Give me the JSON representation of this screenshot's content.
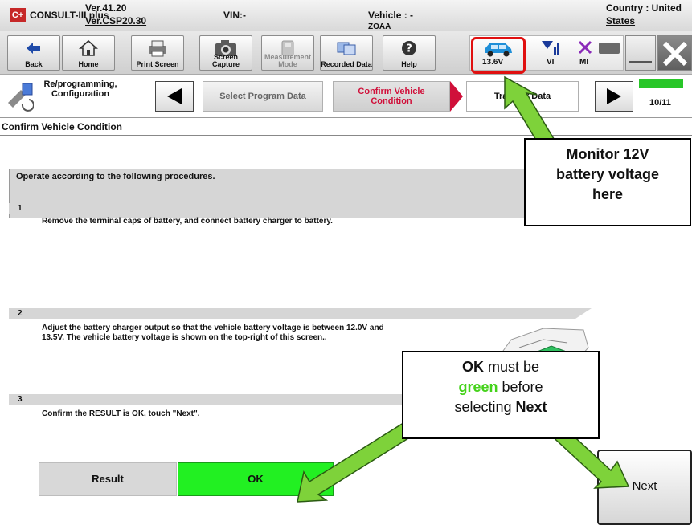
{
  "titlebar": {
    "logo": "C+",
    "app_name": "CONSULT-III plus",
    "version_line1": "Ver.41.20",
    "version_line2": "Ver.CSP20.30",
    "vin": "VIN:-",
    "vehicle": "Vehicle : -",
    "vehicle_overflow": "ZOAA",
    "country_line1": "Country : United",
    "country_line2": "States"
  },
  "toolbar": {
    "back": "Back",
    "home": "Home",
    "print_screen": "Print Screen",
    "screen_capture": "Screen Capture",
    "measurement_mode": "Measurement Mode",
    "recorded_data": "Recorded Data",
    "help": "Help",
    "battery_voltage": "13.6V",
    "vi": "VI",
    "mi": "MI"
  },
  "stepbar": {
    "section_line1": "Re/programming,",
    "section_line2": "Configuration",
    "step_select": "Select Program Data",
    "step_confirm_line1": "Confirm Vehicle",
    "step_confirm_line2": "Condition",
    "step_transfer": "Transfer Data",
    "progress_fraction": 0.91,
    "progress_count": "10/11"
  },
  "content": {
    "screen_title": "Confirm Vehicle Condition",
    "instruction": "Operate according to the following procedures.",
    "steps": [
      {
        "num": "1",
        "text": "Remove the terminal caps of battery, and connect battery charger to battery."
      },
      {
        "num": "2",
        "text_line1": "Adjust the battery charger output so that the vehicle battery voltage is between 12.0V and",
        "text_line2": "13.5V. The vehicle battery voltage is shown on the top-right of this screen.."
      },
      {
        "num": "3",
        "text": "Confirm the RESULT is OK, touch \"Next\"."
      }
    ],
    "result_label": "Result",
    "result_value": "OK",
    "next_button": "Next"
  },
  "callouts": {
    "monitor_line1": "Monitor 12V",
    "monitor_line2": "battery voltage",
    "monitor_line3": "here",
    "ok_word": "OK",
    "ok_rest1": " must be",
    "green_word": "green",
    "ok_rest2": " before",
    "ok_rest3": "selecting ",
    "next_word": "Next"
  },
  "colors": {
    "ok_green": "#22f022",
    "highlight_red": "#e01010",
    "active_step": "#d0103a",
    "arrow_green": "#7ed23a"
  }
}
